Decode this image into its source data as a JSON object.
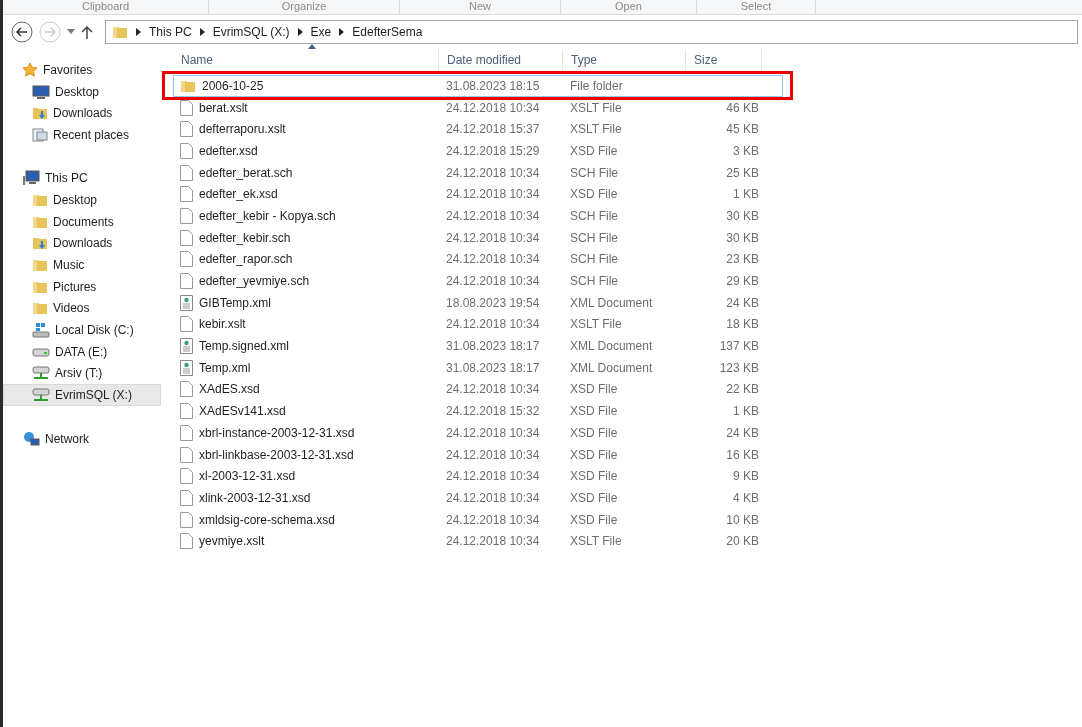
{
  "ribbon_groups": [
    "Clipboard",
    "Organize",
    "New",
    "Open",
    "Select"
  ],
  "breadcrumb": [
    "This PC",
    "EvrimSQL (X:)",
    "Exe",
    "EdefterSema"
  ],
  "sidebar": [
    {
      "label": "Favorites",
      "kind": "star",
      "selected": false,
      "children": [
        {
          "label": "Desktop",
          "kind": "desktop",
          "selected": false
        },
        {
          "label": "Downloads",
          "kind": "downloads",
          "selected": false
        },
        {
          "label": "Recent places",
          "kind": "recent",
          "selected": false
        }
      ]
    },
    {
      "label": "This PC",
      "kind": "pc",
      "selected": false,
      "children": [
        {
          "label": "Desktop",
          "kind": "folder",
          "selected": false
        },
        {
          "label": "Documents",
          "kind": "folder",
          "selected": false
        },
        {
          "label": "Downloads",
          "kind": "downloads",
          "selected": false
        },
        {
          "label": "Music",
          "kind": "folder",
          "selected": false
        },
        {
          "label": "Pictures",
          "kind": "folder",
          "selected": false
        },
        {
          "label": "Videos",
          "kind": "folder",
          "selected": false
        },
        {
          "label": "Local Disk (C:)",
          "kind": "disk",
          "selected": false
        },
        {
          "label": "DATA (E:)",
          "kind": "drive",
          "selected": false
        },
        {
          "label": "Arsiv  (T:)",
          "kind": "netdrive",
          "selected": false
        },
        {
          "label": "EvrimSQL (X:)",
          "kind": "netdrive",
          "selected": true
        }
      ]
    },
    {
      "label": "Network",
      "kind": "network",
      "selected": false
    }
  ],
  "table": {
    "columns": [
      "Name",
      "Date modified",
      "Type",
      "Size"
    ],
    "rows": [
      {
        "kind": "folder",
        "name": "2006-10-25",
        "date": "31.08.2023 18:15",
        "type": "File folder",
        "selected": true,
        "highlighted": true
      },
      {
        "kind": "file",
        "name": "berat.xslt",
        "date": "24.12.2018 10:34",
        "type": "XSLT File",
        "size": "46 KB",
        "selected": false,
        "highlighted": false
      },
      {
        "kind": "file",
        "name": "defterraporu.xslt",
        "date": "24.12.2018 15:37",
        "type": "XSLT File",
        "size": "45 KB",
        "selected": false,
        "highlighted": false
      },
      {
        "kind": "file",
        "name": "edefter.xsd",
        "date": "24.12.2018 15:29",
        "type": "XSD File",
        "size": "3 KB",
        "selected": false,
        "highlighted": false
      },
      {
        "kind": "file",
        "name": "edefter_berat.sch",
        "date": "24.12.2018 10:34",
        "type": "SCH File",
        "size": "25 KB",
        "selected": false,
        "highlighted": false
      },
      {
        "kind": "file",
        "name": "edefter_ek.xsd",
        "date": "24.12.2018 10:34",
        "type": "XSD File",
        "size": "1 KB",
        "selected": false,
        "highlighted": false
      },
      {
        "kind": "file",
        "name": "edefter_kebir - Kopya.sch",
        "date": "24.12.2018 10:34",
        "type": "SCH File",
        "size": "30 KB",
        "selected": false,
        "highlighted": false
      },
      {
        "kind": "file",
        "name": "edefter_kebir.sch",
        "date": "24.12.2018 10:34",
        "type": "SCH File",
        "size": "30 KB",
        "selected": false,
        "highlighted": false
      },
      {
        "kind": "file",
        "name": "edefter_rapor.sch",
        "date": "24.12.2018 10:34",
        "type": "SCH File",
        "size": "23 KB",
        "selected": false,
        "highlighted": false
      },
      {
        "kind": "file",
        "name": "edefter_yevmiye.sch",
        "date": "24.12.2018 10:34",
        "type": "SCH File",
        "size": "29 KB",
        "selected": false,
        "highlighted": false
      },
      {
        "kind": "xml",
        "name": "GIBTemp.xml",
        "date": "18.08.2023 19:54",
        "type": "XML Document",
        "size": "24 KB",
        "selected": false,
        "highlighted": false
      },
      {
        "kind": "file",
        "name": "kebir.xslt",
        "date": "24.12.2018 10:34",
        "type": "XSLT File",
        "size": "18 KB",
        "selected": false,
        "highlighted": false
      },
      {
        "kind": "xml",
        "name": "Temp.signed.xml",
        "date": "31.08.2023 18:17",
        "type": "XML Document",
        "size": "137 KB",
        "selected": false,
        "highlighted": false
      },
      {
        "kind": "xml",
        "name": "Temp.xml",
        "date": "31.08.2023 18:17",
        "type": "XML Document",
        "size": "123 KB",
        "selected": false,
        "highlighted": false
      },
      {
        "kind": "file",
        "name": "XAdES.xsd",
        "date": "24.12.2018 10:34",
        "type": "XSD File",
        "size": "22 KB",
        "selected": false,
        "highlighted": false
      },
      {
        "kind": "file",
        "name": "XAdESv141.xsd",
        "date": "24.12.2018 15:32",
        "type": "XSD File",
        "size": "1 KB",
        "selected": false,
        "highlighted": false
      },
      {
        "kind": "file",
        "name": "xbrl-instance-2003-12-31.xsd",
        "date": "24.12.2018 10:34",
        "type": "XSD File",
        "size": "24 KB",
        "selected": false,
        "highlighted": false
      },
      {
        "kind": "file",
        "name": "xbrl-linkbase-2003-12-31.xsd",
        "date": "24.12.2018 10:34",
        "type": "XSD File",
        "size": "16 KB",
        "selected": false,
        "highlighted": false
      },
      {
        "kind": "file",
        "name": "xl-2003-12-31.xsd",
        "date": "24.12.2018 10:34",
        "type": "XSD File",
        "size": "9 KB",
        "selected": false,
        "highlighted": false
      },
      {
        "kind": "file",
        "name": "xlink-2003-12-31.xsd",
        "date": "24.12.2018 10:34",
        "type": "XSD File",
        "size": "4 KB",
        "selected": false,
        "highlighted": false
      },
      {
        "kind": "file",
        "name": "xmldsig-core-schema.xsd",
        "date": "24.12.2018 10:34",
        "type": "XSD File",
        "size": "10 KB",
        "selected": false,
        "highlighted": false
      },
      {
        "kind": "file",
        "name": "yevmiye.xslt",
        "date": "24.12.2018 10:34",
        "type": "XSLT File",
        "size": "20 KB",
        "selected": false,
        "highlighted": false
      }
    ]
  }
}
